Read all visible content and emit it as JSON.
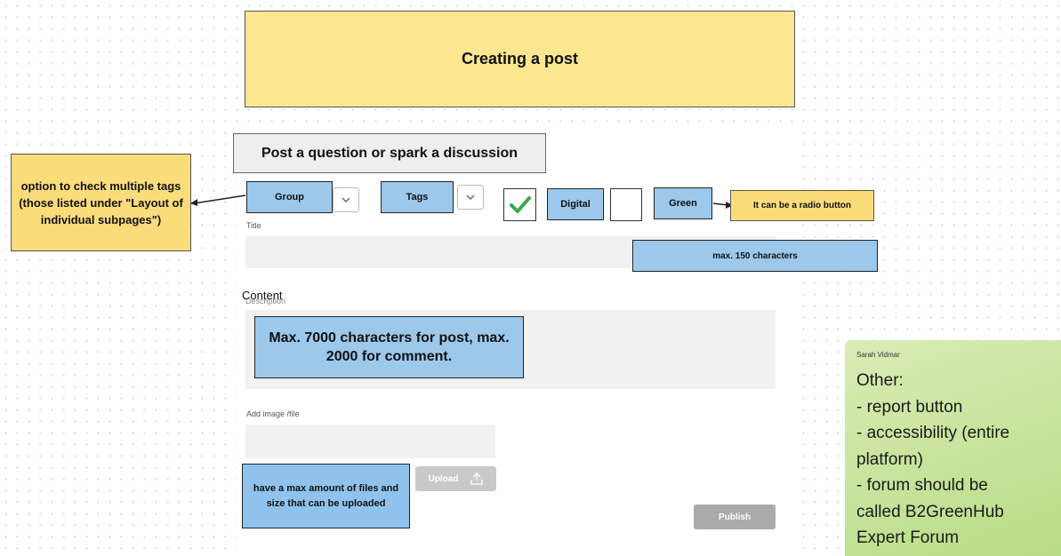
{
  "banner": {
    "title": "Creating a post"
  },
  "form": {
    "heading": "Post a question or spark a discussion",
    "group_label": "Group",
    "tags_label": "Tags",
    "option_digital": "Digital",
    "option_green": "Green",
    "title_label": "Title",
    "content_label": "Content",
    "content_label_overlay": "Description",
    "attach_label": "Add image /file",
    "upload_label": "Upload",
    "publish_label": "Publish"
  },
  "annotations": {
    "multiple_tags": "option to check multiple tags (those listed under \"Layout of individual subpages\")",
    "radio_button": "It can be a radio button",
    "title_limit": "max. 150 characters",
    "content_limit": "Max. 7000 characters for post, max. 2000 for comment.",
    "files_limit": "have a max amount of files and size that can be uploaded"
  },
  "sticky_note": {
    "author": "Sarah Vidmar",
    "lines": [
      "Other:",
      "- report button",
      "- accessibility (entire",
      "platform)",
      "- forum should be",
      "called B2GreenHub",
      "Expert Forum"
    ]
  },
  "checkboxes": {
    "digital_checked": true,
    "green_checked": false
  },
  "icons": {
    "dropdown": "chevron-down-icon",
    "upload": "upload-icon",
    "check": "checkmark-icon"
  },
  "colors": {
    "banner": "#fce68f",
    "annotation_blue": "#9cc8ec",
    "annotation_yellow": "#fbdc7a",
    "sticky_note": "#c6e29a",
    "check_green": "#3aa84a"
  }
}
